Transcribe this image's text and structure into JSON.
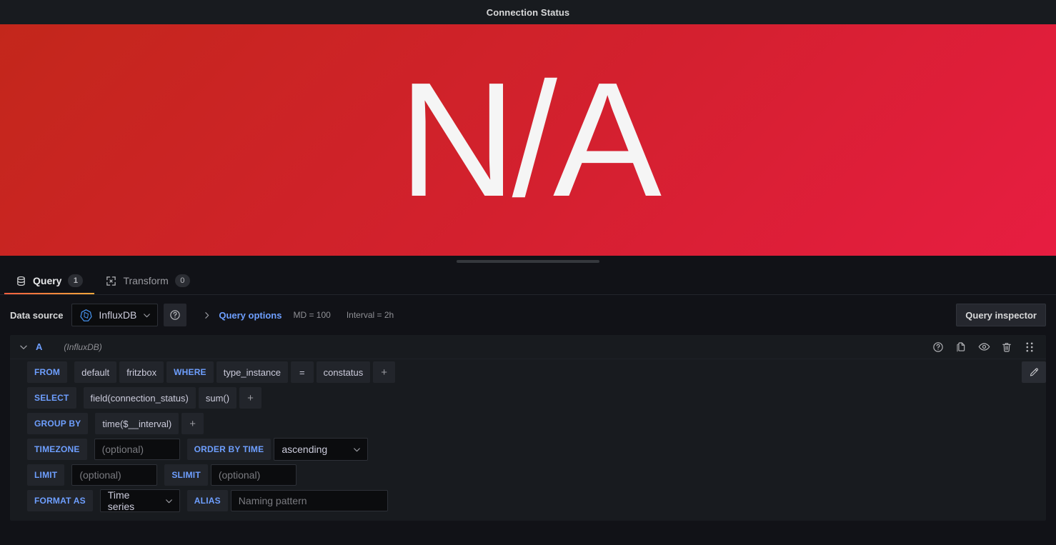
{
  "panel": {
    "title": "Connection Status",
    "value": "N/A",
    "background_start": "#c3271b",
    "background_end": "#e71d41"
  },
  "tabs": [
    {
      "label": "Query",
      "count": "1",
      "icon": "database-icon",
      "active": true
    },
    {
      "label": "Transform",
      "count": "0",
      "icon": "transform-icon",
      "active": false
    }
  ],
  "datasource_row": {
    "label": "Data source",
    "selected": "InfluxDB",
    "help_icon": "question-circle-icon",
    "query_options": {
      "title": "Query options",
      "max_data_points": "MD = 100",
      "interval": "Interval = 2h"
    },
    "query_inspector": "Query inspector"
  },
  "query": {
    "ref_id": "A",
    "datasource_hint": "(InfluxDB)",
    "actions": [
      {
        "name": "help-icon",
        "title": "Show data source help"
      },
      {
        "name": "copy-icon",
        "title": "Duplicate query"
      },
      {
        "name": "eye-icon",
        "title": "Disable/enable query"
      },
      {
        "name": "trash-icon",
        "title": "Remove query"
      },
      {
        "name": "drag-handle-icon",
        "title": "Drag and drop to reorder"
      }
    ],
    "edit_sql_icon": "pencil-icon",
    "rows": {
      "from": {
        "keyword": "FROM",
        "policy": "default",
        "measurement": "fritzbox",
        "where_keyword": "WHERE",
        "tag_key": "type_instance",
        "operator": "=",
        "tag_value": "constatus",
        "add": "+"
      },
      "select": {
        "keyword": "SELECT",
        "field": "field(connection_status)",
        "aggregate": "sum()",
        "add": "+"
      },
      "group_by": {
        "keyword": "GROUP BY",
        "time": "time($__interval)",
        "add": "+"
      },
      "timezone": {
        "keyword": "TIMEZONE",
        "value": "",
        "placeholder": "(optional)",
        "order_keyword": "ORDER BY TIME",
        "order_value": "ascending"
      },
      "limit": {
        "keyword": "LIMIT",
        "value": "",
        "placeholder": "(optional)",
        "slimit_keyword": "SLIMIT",
        "slimit_value": "",
        "slimit_placeholder": "(optional)"
      },
      "format": {
        "keyword": "FORMAT AS",
        "value": "Time series",
        "alias_keyword": "ALIAS",
        "alias_value": "",
        "alias_placeholder": "Naming pattern"
      }
    }
  }
}
